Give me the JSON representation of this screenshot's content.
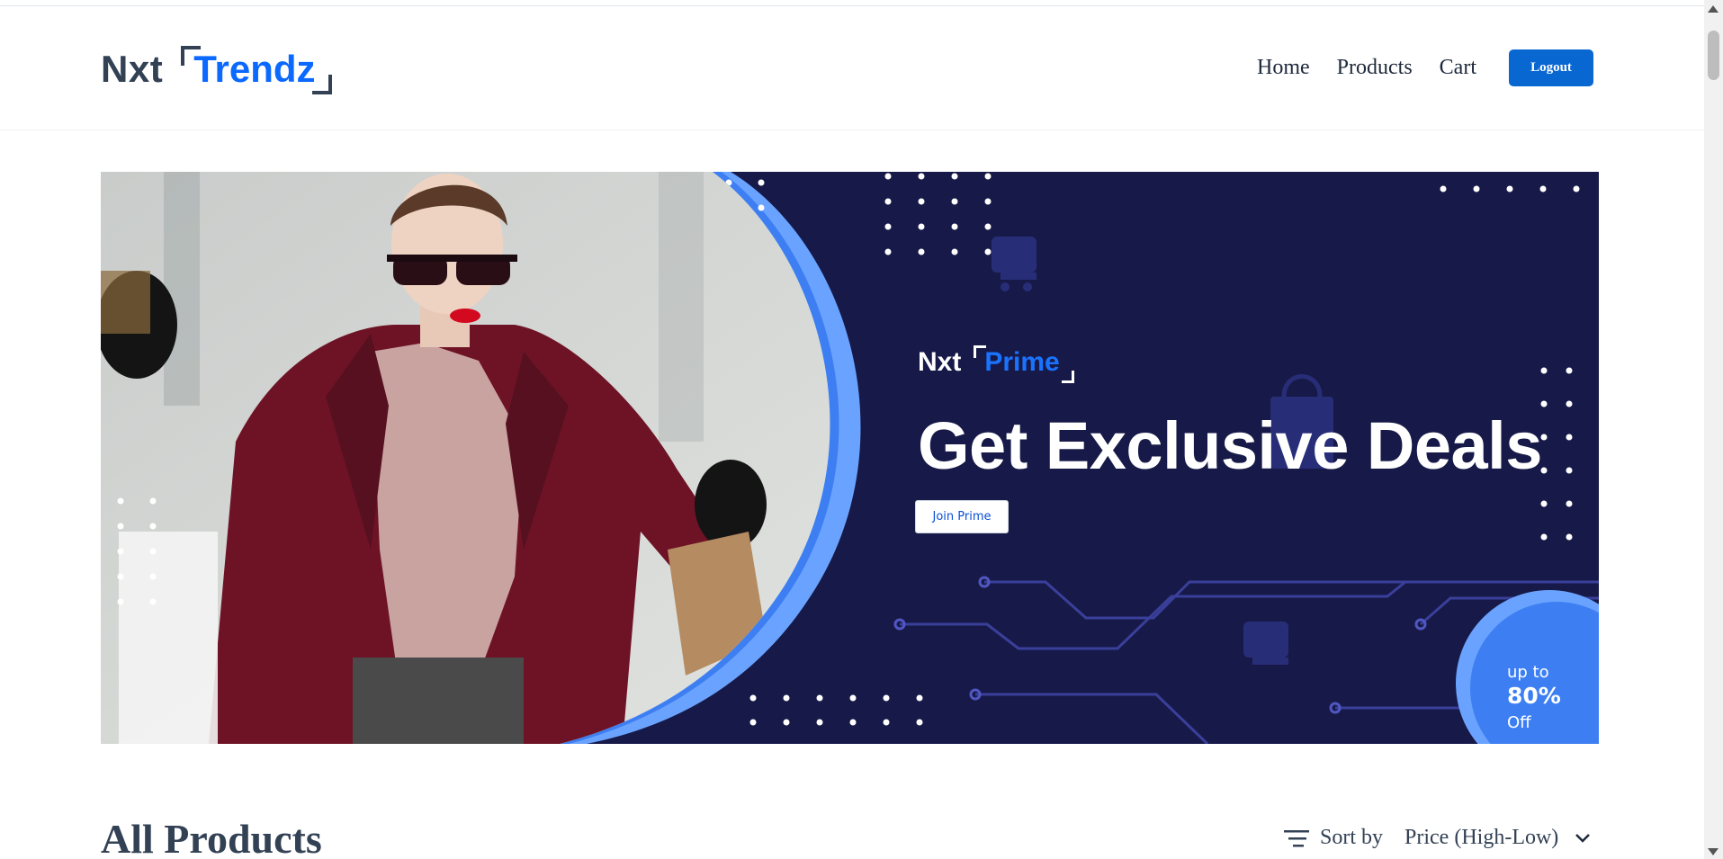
{
  "header": {
    "logo_part1": "Nxt",
    "logo_part2": "Trendz",
    "nav": [
      {
        "label": "Home"
      },
      {
        "label": "Products"
      },
      {
        "label": "Cart"
      }
    ],
    "logout_label": "Logout"
  },
  "banner": {
    "logo_part1": "Nxt",
    "logo_part2": "Prime",
    "heading": "Get Exclusive Deals",
    "button_label": "Join Prime",
    "offer_line1": "up to",
    "offer_line2": "80%",
    "offer_line3": "Off"
  },
  "products": {
    "title": "All Products",
    "sort_label": "Sort by",
    "sort_value": "Price (High-Low)"
  },
  "colors": {
    "brand_blue": "#0b69ff",
    "button_blue": "#0967d2",
    "banner_navy": "#171a48",
    "accent_blue": "#3b82f6",
    "text_dark": "#334155"
  },
  "icons": [
    "filter-sort-icon",
    "chevron-down-icon",
    "shopping-cart-icon",
    "shopping-bag-icon"
  ]
}
